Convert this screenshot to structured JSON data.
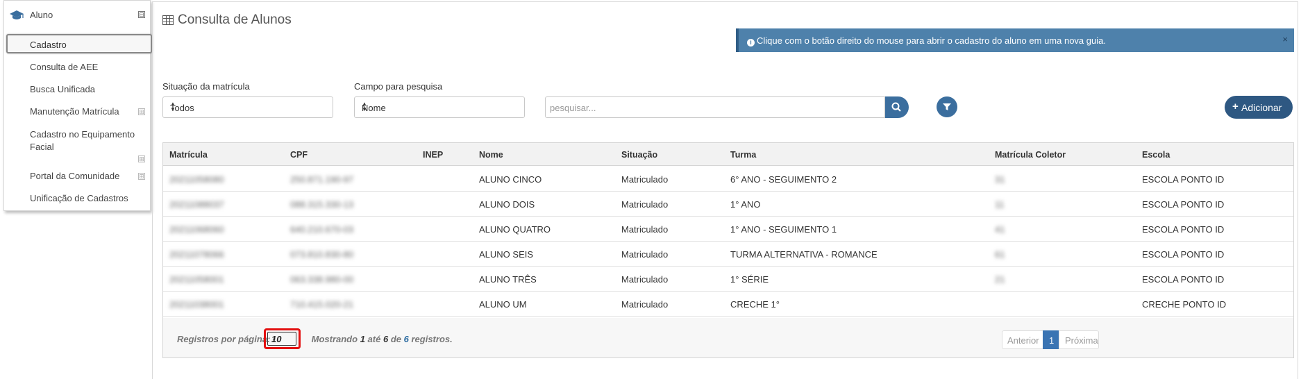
{
  "sidebar": {
    "title": "Aluno",
    "collapse_symbol": "⊟",
    "expand_symbol": "⊞",
    "items": [
      {
        "label": "Cadastro"
      },
      {
        "label": "Consulta de AEE"
      },
      {
        "label": "Busca Unificada"
      },
      {
        "label": "Manutenção Matrícula"
      },
      {
        "label": "Cadastro no Equipamento Facial"
      },
      {
        "label": "Portal da Comunidade"
      },
      {
        "label": "Unificação de Cadastros"
      }
    ]
  },
  "page": {
    "title": "Consulta de Alunos"
  },
  "alert": {
    "icon": "info-icon",
    "info_glyph": "i",
    "text": "Clique com o botão direito do mouse para abrir o cadastro do aluno em uma nova guia.",
    "close": "×"
  },
  "filters": {
    "situacao_label": "Situação da matrícula",
    "situacao_value": "Todos",
    "campo_label": "Campo para pesquisa",
    "campo_value": "Nome",
    "search_placeholder": "pesquisar..."
  },
  "buttons": {
    "add_label": "Adicionar",
    "add_symbol": "+"
  },
  "table": {
    "headers": [
      "Matrícula",
      "CPF",
      "INEP",
      "Nome",
      "Situação",
      "Turma",
      "Matrícula Coletor",
      "Escola"
    ],
    "rows": [
      {
        "matricula": "20211058080",
        "cpf": "250.871.190-97",
        "inep": "",
        "nome": "ALUNO CINCO",
        "situacao": "Matriculado",
        "turma": "6° ANO - SEGUIMENTO 2",
        "coletor": "31",
        "escola": "ESCOLA PONTO ID"
      },
      {
        "matricula": "20211088037",
        "cpf": "088.315.330-13",
        "inep": "",
        "nome": "ALUNO DOIS",
        "situacao": "Matriculado",
        "turma": "1° ANO",
        "coletor": "11",
        "escola": "ESCOLA PONTO ID"
      },
      {
        "matricula": "20211068060",
        "cpf": "640.210.670-03",
        "inep": "",
        "nome": "ALUNO QUATRO",
        "situacao": "Matriculado",
        "turma": "1° ANO - SEGUIMENTO 1",
        "coletor": "41",
        "escola": "ESCOLA PONTO ID"
      },
      {
        "matricula": "20211078066",
        "cpf": "073.810.830-80",
        "inep": "",
        "nome": "ALUNO SEIS",
        "situacao": "Matriculado",
        "turma": "TURMA ALTERNATIVA - ROMANCE",
        "coletor": "61",
        "escola": "ESCOLA PONTO ID"
      },
      {
        "matricula": "20211058001",
        "cpf": "063.338.980-00",
        "inep": "",
        "nome": "ALUNO TRÊS",
        "situacao": "Matriculado",
        "turma": "1° SÉRIE",
        "coletor": "21",
        "escola": "ESCOLA PONTO ID"
      },
      {
        "matricula": "20211038001",
        "cpf": "710.415.020-21",
        "inep": "",
        "nome": "ALUNO UM",
        "situacao": "Matriculado",
        "turma": "CRECHE 1°",
        "coletor": "",
        "escola": "CRECHE PONTO ID"
      }
    ]
  },
  "footer": {
    "per_page_label": "Registros por página:",
    "per_page_value": "10",
    "showing_prefix": "Mostrando",
    "from": "1",
    "to_word": "até",
    "to": "6",
    "of_word": "de",
    "total": "6",
    "suffix": "registros.",
    "pager_prev": "Anterior",
    "pager_current": "1",
    "pager_next": "Próxima"
  },
  "colors": {
    "accent": "#3b6e9e",
    "alert_bg": "#4e81ab",
    "highlight": "#e31010"
  }
}
